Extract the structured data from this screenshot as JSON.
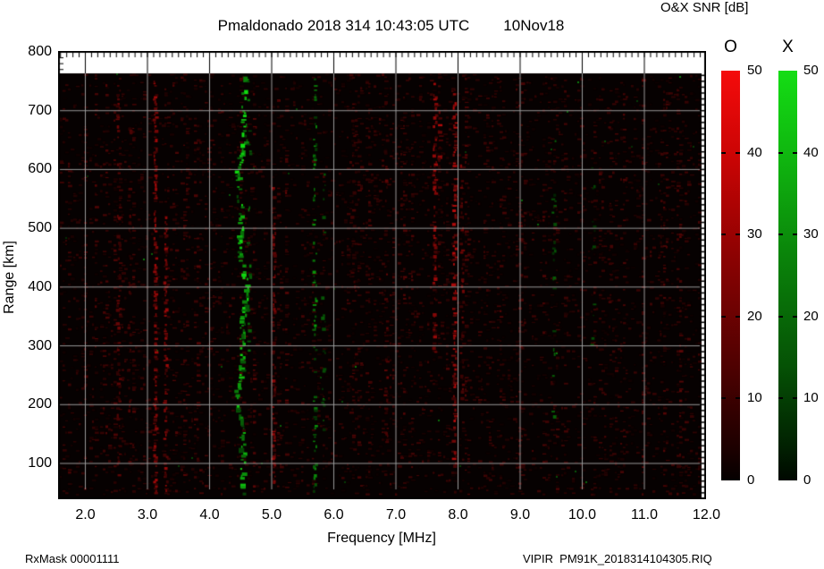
{
  "title": {
    "station_line": "Pmaldonado 2018 314 10:43:05 UTC",
    "date": "10Nov18"
  },
  "header": {
    "colorbar_title": "O&X SNR [dB]"
  },
  "footer": {
    "rx_mask": "RxMask 00001111",
    "file": "VIPIR  PM91K_2018314104305.RIQ"
  },
  "chart_data": {
    "type": "heatmap",
    "title": "Pmaldonado 2018 314 10:43:05 UTC  10Nov18",
    "xlabel": "Frequency [MHz]",
    "ylabel": "Range [km]",
    "colorbar_title": "O&X SNR [dB]",
    "x_range_mhz": [
      1.57,
      12.0
    ],
    "y_range_km": [
      40,
      800
    ],
    "x_ticks": {
      "labels": [
        "2.0",
        "3.0",
        "4.0",
        "5.0",
        "6.0",
        "7.0",
        "8.0",
        "9.0",
        "10.0",
        "11.0",
        "12.0"
      ],
      "values": [
        2,
        3,
        4,
        5,
        6,
        7,
        8,
        9,
        10,
        11,
        12
      ]
    },
    "y_ticks": {
      "labels": [
        "800",
        "700",
        "600",
        "500",
        "400",
        "300",
        "200",
        "100"
      ],
      "values": [
        800,
        700,
        600,
        500,
        400,
        300,
        200,
        100
      ]
    },
    "grid": true,
    "grid_color": "#a0a0a0",
    "background": "#060101",
    "colorbars": [
      {
        "label": "O",
        "color": "#f50b0b",
        "ticks": [
          50,
          40,
          30,
          20,
          10,
          0
        ]
      },
      {
        "label": "X",
        "color": "#14dd14",
        "ticks": [
          50,
          40,
          30,
          20,
          10,
          0
        ]
      }
    ],
    "snr_scale_db": [
      0,
      50
    ],
    "interference_bands": [
      {
        "mhz": 2.54,
        "pol": "O",
        "km": [
          60,
          755
        ],
        "density": 0.32,
        "peak": 110,
        "max_w": 3,
        "jitter": 1.5
      },
      {
        "mhz": 2.72,
        "pol": "O",
        "km": [
          100,
          740
        ],
        "density": 0.18,
        "peak": 85,
        "max_w": 3,
        "jitter": 1.5
      },
      {
        "mhz": 3.13,
        "pol": "O",
        "km": [
          50,
          755
        ],
        "density": 0.55,
        "peak": 165,
        "max_w": 3,
        "jitter": 1.5
      },
      {
        "mhz": 3.3,
        "pol": "O",
        "km": [
          45,
          520
        ],
        "density": 0.5,
        "peak": 160,
        "max_w": 3,
        "jitter": 1.5
      },
      {
        "mhz": 5.04,
        "pol": "O",
        "km": [
          60,
          570
        ],
        "density": 0.45,
        "peak": 150,
        "max_w": 3,
        "jitter": 1.5
      },
      {
        "mhz": 6.32,
        "pol": "O",
        "km": [
          120,
          700
        ],
        "density": 0.14,
        "peak": 75,
        "max_w": 3,
        "jitter": 1.5
      },
      {
        "mhz": 6.85,
        "pol": "O",
        "km": [
          100,
          720
        ],
        "density": 0.28,
        "peak": 110,
        "max_w": 3,
        "jitter": 1.5
      },
      {
        "mhz": 7.63,
        "pol": "O",
        "km": [
          290,
          755
        ],
        "density": 0.5,
        "peak": 165,
        "max_w": 3,
        "jitter": 1.5
      },
      {
        "mhz": 7.72,
        "pol": "O",
        "km": [
          620,
          700
        ],
        "density": 0.6,
        "peak": 185,
        "max_w": 4,
        "jitter": 2
      },
      {
        "mhz": 7.95,
        "pol": "O",
        "km": [
          90,
          745
        ],
        "density": 0.5,
        "peak": 195,
        "max_w": 4,
        "jitter": 1.5
      },
      {
        "mhz": 8.07,
        "pol": "O",
        "km": [
          200,
          620
        ],
        "density": 0.28,
        "peak": 125,
        "max_w": 3,
        "jitter": 1.5
      },
      {
        "mhz": 9.02,
        "pol": "O",
        "km": [
          120,
          700
        ],
        "density": 0.16,
        "peak": 80,
        "max_w": 3,
        "jitter": 1.5
      },
      {
        "mhz": 10.45,
        "pol": "O",
        "km": [
          300,
          700
        ],
        "density": 0.13,
        "peak": 75,
        "max_w": 3,
        "jitter": 1.5
      },
      {
        "mhz": 11.25,
        "pol": "O",
        "km": [
          150,
          600
        ],
        "density": 0.1,
        "peak": 65,
        "max_w": 3,
        "jitter": 1.5
      },
      {
        "mhz": 4.53,
        "pol": "X",
        "km": [
          42,
          758
        ],
        "density": 0.7,
        "peak": 225,
        "max_w": 5,
        "jitter": 2.5,
        "drift": true
      },
      {
        "mhz": 4.64,
        "pol": "X",
        "km": [
          250,
          720
        ],
        "density": 0.18,
        "peak": 120,
        "max_w": 3,
        "jitter": 2
      },
      {
        "mhz": 5.7,
        "pol": "X",
        "km": [
          45,
          755
        ],
        "density": 0.33,
        "peak": 165,
        "max_w": 3,
        "jitter": 1.5
      },
      {
        "mhz": 5.84,
        "pol": "X",
        "km": [
          120,
          620
        ],
        "density": 0.13,
        "peak": 95,
        "max_w": 3,
        "jitter": 1.5
      },
      {
        "mhz": 9.55,
        "pol": "X",
        "km": [
          160,
          650
        ],
        "density": 0.17,
        "peak": 105,
        "max_w": 3,
        "jitter": 1.5
      },
      {
        "mhz": 10.18,
        "pol": "X",
        "km": [
          220,
          680
        ],
        "density": 0.1,
        "peak": 85,
        "max_w": 3,
        "jitter": 1.5
      }
    ]
  }
}
